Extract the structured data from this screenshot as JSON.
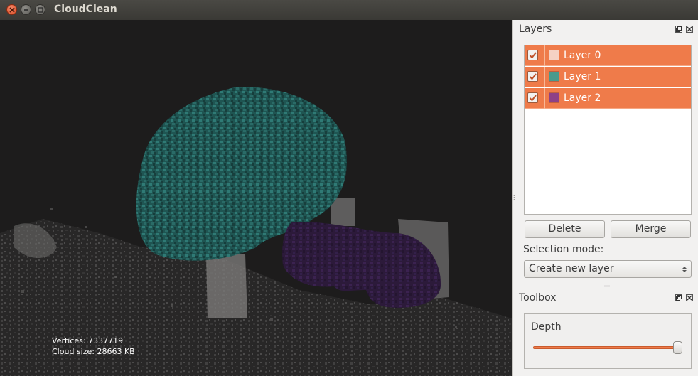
{
  "window": {
    "title": "CloudClean"
  },
  "viewport": {
    "stats": {
      "vertices": "Vertices: 7337719",
      "cloud_size": "Cloud size: 28663 KB"
    }
  },
  "layers_dock": {
    "title": "Layers",
    "layers": [
      {
        "label": "Layer 0",
        "color": "#f5d2c4",
        "checked": true
      },
      {
        "label": "Layer 1",
        "color": "#4a9a8c",
        "checked": true
      },
      {
        "label": "Layer 2",
        "color": "#8e4187",
        "checked": true
      }
    ],
    "delete_label": "Delete",
    "merge_label": "Merge",
    "selection_mode_label": "Selection mode:",
    "selection_mode_value": "Create new layer"
  },
  "toolbox_dock": {
    "title": "Toolbox",
    "depth_label": "Depth",
    "depth_level": 0.98
  },
  "colors": {
    "accent": "#ef7b4a",
    "viewport_bg": "#1d1c1c"
  },
  "icons": [
    "close-icon",
    "minimize-icon",
    "maximize-icon",
    "float-icon",
    "dock-close-icon",
    "checkmark-icon",
    "combo-arrows-icon"
  ]
}
